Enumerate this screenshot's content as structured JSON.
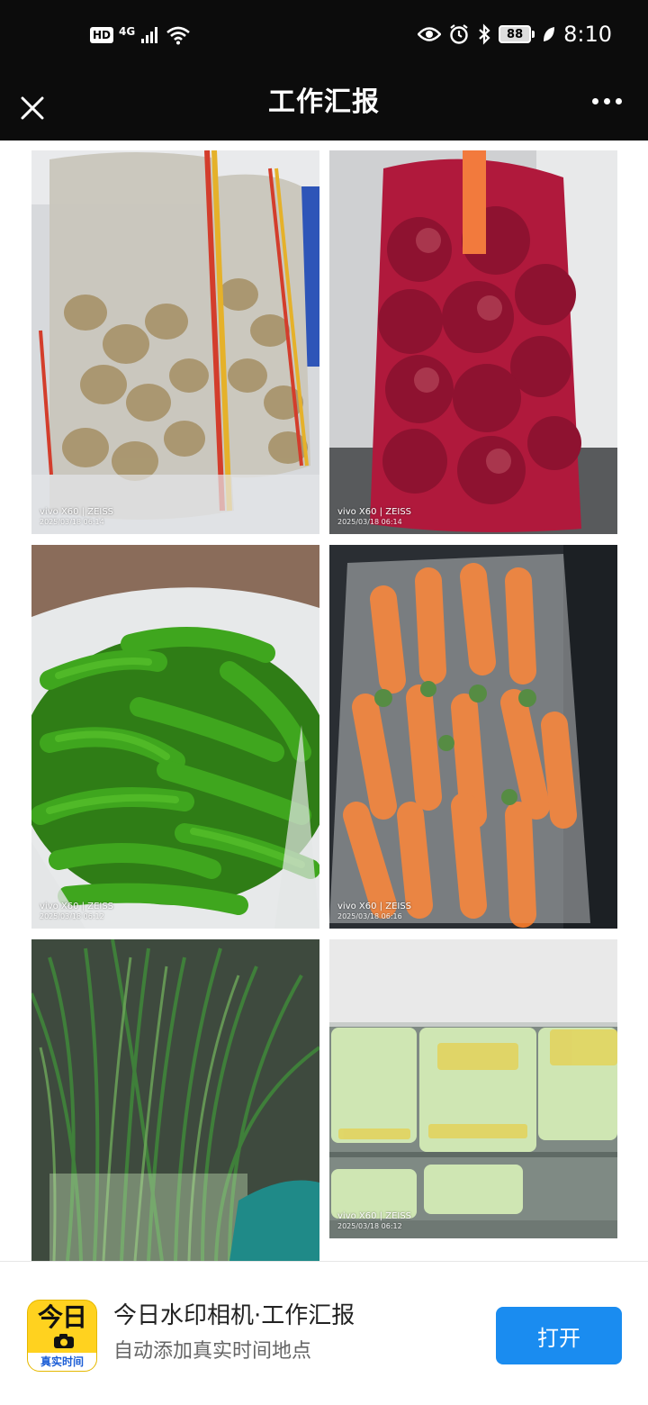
{
  "status_bar": {
    "hd": "HD",
    "network": "4G",
    "battery": "88",
    "time": "8:10",
    "icons": [
      "signal-icon",
      "wifi-icon",
      "eye-icon",
      "alarm-icon",
      "bluetooth-icon",
      "battery-icon",
      "leaf-icon"
    ]
  },
  "nav": {
    "title": "工作汇报",
    "close_icon": "close-icon",
    "more_icon": "more-icon"
  },
  "photos": [
    {
      "subject": "potatoes",
      "model": "vivo X60 | ZEISS",
      "timestamp": "2025/03/18 06:14"
    },
    {
      "subject": "red-onions",
      "model": "vivo X60 | ZEISS",
      "timestamp": "2025/03/18 06:14"
    },
    {
      "subject": "green-peppers",
      "model": "vivo X60 | ZEISS",
      "timestamp": "2025/03/18 06:12"
    },
    {
      "subject": "carrots",
      "model": "vivo X60 | ZEISS",
      "timestamp": "2025/03/18 06:16"
    },
    {
      "subject": "green-onions",
      "model": "",
      "timestamp": ""
    },
    {
      "subject": "cabbage-bags",
      "model": "vivo X60 | ZEISS",
      "timestamp": "2025/03/18 06:12"
    }
  ],
  "banner": {
    "app_icon_text": "今日",
    "app_icon_caption": "真实时间",
    "title": "今日水印相机·工作汇报",
    "subtitle": "自动添加真实时间地点",
    "open_label": "打开"
  },
  "colors": {
    "bar_bg": "#0c0c0c",
    "accent_blue": "#1a8cf0",
    "app_icon_yellow": "#ffd21f"
  }
}
